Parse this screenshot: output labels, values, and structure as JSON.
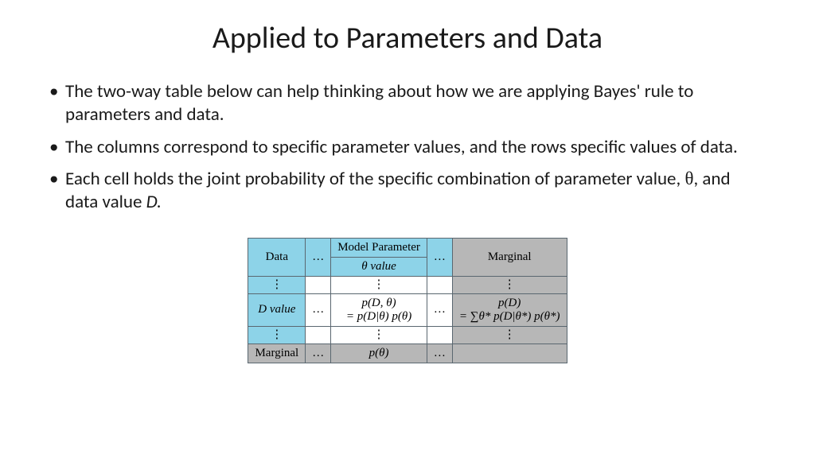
{
  "title": "Applied to Parameters and Data",
  "bullets": [
    "The two-way table below can help thinking about how we are applying Bayes' rule to parameters and data.",
    "The columns correspond to specific parameter values, and the rows specific values of data.",
    "Each cell holds the joint probability of the specific combination of parameter value, θ, and data value D."
  ],
  "table": {
    "header": {
      "data": "Data",
      "model_parameter": "Model Parameter",
      "theta_value": "θ value",
      "marginal": "Marginal",
      "ellipsis": "…",
      "vdots": "⋮"
    },
    "row_label": "D value",
    "joint_line1": "p(D, θ)",
    "joint_line2": "= p(D|θ) p(θ)",
    "pd_line1": "p(D)",
    "pd_line2": "= ∑θ* p(D|θ*) p(θ*)",
    "p_theta": "p(θ)",
    "bottom_marginal": "Marginal"
  },
  "chart_data": {
    "type": "table",
    "title": "Joint probability table for Bayes' rule (parameters vs data)",
    "columns": [
      "Data \\ Model Parameter",
      "…",
      "θ value",
      "…",
      "Marginal"
    ],
    "rows": [
      [
        "⋮",
        "",
        "⋮",
        "",
        "⋮"
      ],
      [
        "D value",
        "…",
        "p(D, θ) = p(D|θ) p(θ)",
        "…",
        "p(D) = ∑θ* p(D|θ*) p(θ*)"
      ],
      [
        "⋮",
        "",
        "⋮",
        "",
        "⋮"
      ],
      [
        "Marginal",
        "…",
        "p(θ)",
        "…",
        ""
      ]
    ]
  }
}
